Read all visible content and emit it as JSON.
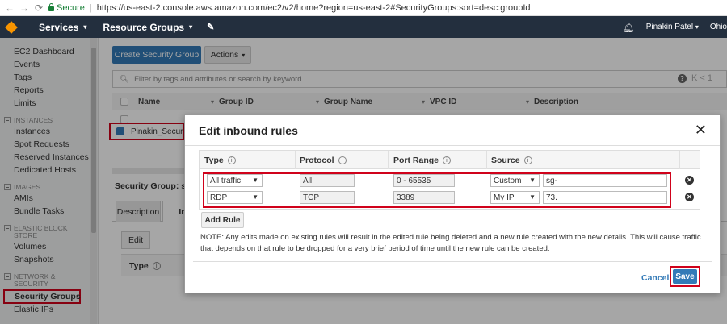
{
  "browser": {
    "back": "←",
    "forward": "→",
    "reload": "⟳",
    "secure_label": "Secure",
    "url": "https://us-east-2.console.aws.amazon.com/ec2/v2/home?region=us-east-2#SecurityGroups:sort=desc:groupId"
  },
  "topbar": {
    "services": "Services",
    "resource_groups": "Resource Groups",
    "user": "Pinakin Patel",
    "region": "Ohio"
  },
  "sidebar": {
    "items_top": [
      "EC2 Dashboard",
      "Events",
      "Tags",
      "Reports",
      "Limits"
    ],
    "instances_header": "INSTANCES",
    "instances": [
      "Instances",
      "Spot Requests",
      "Reserved Instances",
      "Dedicated Hosts"
    ],
    "images_header": "IMAGES",
    "images": [
      "AMIs",
      "Bundle Tasks"
    ],
    "ebs_header": "ELASTIC BLOCK STORE",
    "ebs": [
      "Volumes",
      "Snapshots"
    ],
    "network_header": "NETWORK & SECURITY",
    "network": [
      "Security Groups",
      "Elastic IPs"
    ]
  },
  "main": {
    "create_button": "Create Security Group",
    "actions_button": "Actions",
    "filter_placeholder": "Filter by tags and attributes or search by keyword",
    "pager": "K < 1",
    "columns": {
      "name": "Name",
      "group_id": "Group ID",
      "group_name": "Group Name",
      "vpc_id": "VPC ID",
      "description": "Description"
    },
    "selected_row_name": "Pinakin_Secur",
    "security_group_label": "Security Group: sg-",
    "tabs": [
      "Description",
      "In"
    ],
    "edit_button": "Edit",
    "sub_header": "Type"
  },
  "modal": {
    "title": "Edit inbound rules",
    "close": "✕",
    "headers": {
      "type": "Type",
      "protocol": "Protocol",
      "port_range": "Port Range",
      "source": "Source"
    },
    "rules": [
      {
        "type": "All traffic",
        "protocol": "All",
        "port_range": "0 - 65535",
        "source_type": "Custom",
        "source_value": "sg-"
      },
      {
        "type": "RDP",
        "protocol": "TCP",
        "port_range": "3389",
        "source_type": "My IP",
        "source_value": "73."
      }
    ],
    "add_rule": "Add Rule",
    "note": "NOTE: Any edits made on existing rules will result in the edited rule being deleted and a new rule created with the new details. This will cause traffic that depends on that rule to be dropped for a very brief period of time until the new rule can be created.",
    "cancel": "Cancel",
    "save": "Save"
  },
  "colors": {
    "aws_nav": "#232f3e",
    "primary_blue": "#337ab7",
    "highlight_red": "#d0021b",
    "aws_orange": "#f79400"
  }
}
